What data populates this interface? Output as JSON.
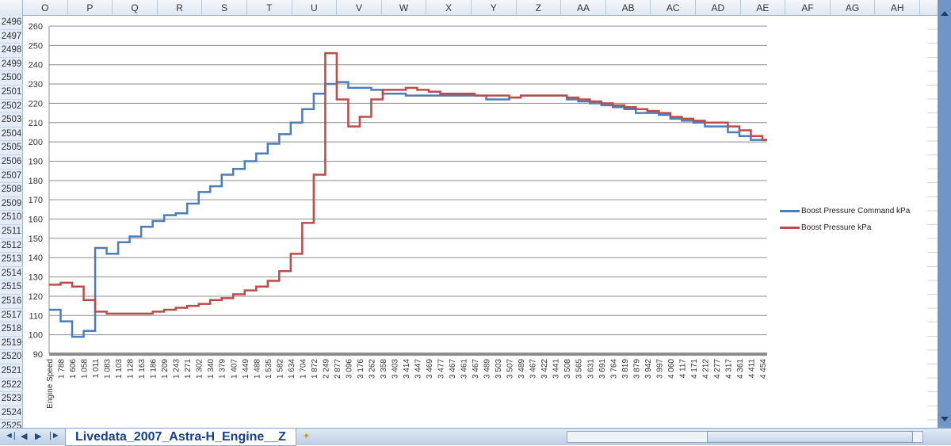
{
  "columns": [
    "O",
    "P",
    "Q",
    "R",
    "S",
    "T",
    "U",
    "V",
    "W",
    "X",
    "Y",
    "Z",
    "AA",
    "AB",
    "AC",
    "AD",
    "AE",
    "AF",
    "AG",
    "AH"
  ],
  "rows": [
    "2496",
    "2497",
    "2498",
    "2499",
    "2500",
    "2501",
    "2502",
    "2503",
    "2504",
    "2505",
    "2506",
    "2507",
    "2508",
    "2509",
    "2510",
    "2511",
    "2512",
    "2513",
    "2514",
    "2515",
    "2516",
    "2517",
    "2518",
    "2519",
    "2520",
    "2521",
    "2522",
    "2523",
    "2524",
    "2525"
  ],
  "sheet_tab": "Livedata_2007_Astra-H_Engine__Z",
  "colors": {
    "command": "#4a7ebb",
    "actual": "#be4b48"
  },
  "chart_data": {
    "type": "line",
    "title": "",
    "xlabel": "",
    "ylabel": "",
    "ylim": [
      90,
      260
    ],
    "yticks": [
      90,
      100,
      110,
      120,
      130,
      140,
      150,
      160,
      170,
      180,
      190,
      200,
      210,
      220,
      230,
      240,
      250,
      260
    ],
    "grid": true,
    "legend_position": "right",
    "categories": [
      "Engine Speed",
      "1 788",
      "1 606",
      "1 058",
      "1 011",
      "1 083",
      "1 103",
      "1 128",
      "1 163",
      "1 186",
      "1 209",
      "1 243",
      "1 271",
      "1 302",
      "1 340",
      "1 379",
      "1 407",
      "1 449",
      "1 488",
      "1 535",
      "1 582",
      "1 634",
      "1 704",
      "1 872",
      "2 249",
      "2 877",
      "3 096",
      "3 176",
      "3 262",
      "3 358",
      "3 403",
      "3 414",
      "3 447",
      "3 469",
      "3 477",
      "3 467",
      "3 461",
      "3 467",
      "3 489",
      "3 503",
      "3 507",
      "3 489",
      "3 467",
      "3 422",
      "3 441",
      "3 508",
      "3 565",
      "3 631",
      "3 691",
      "3 764",
      "3 819",
      "3 879",
      "3 942",
      "3 997",
      "4 060",
      "4 117",
      "4 171",
      "4 212",
      "4 277",
      "4 317",
      "4 361",
      "4 411",
      "4 454"
    ],
    "series": [
      {
        "name": "Boost Pressure Command  kPa",
        "values": [
          113,
          107,
          99,
          102,
          145,
          142,
          148,
          151,
          156,
          159,
          162,
          163,
          168,
          174,
          177,
          183,
          186,
          190,
          194,
          199,
          204,
          210,
          217,
          225,
          230,
          231,
          228,
          228,
          227,
          225,
          225,
          224,
          224,
          224,
          224,
          224,
          224,
          224,
          222,
          222,
          223,
          224,
          224,
          224,
          224,
          222,
          221,
          220,
          219,
          218,
          217,
          215,
          215,
          214,
          212,
          211,
          210,
          208,
          208,
          205,
          203,
          201,
          201
        ]
      },
      {
        "name": "Boost Pressure kPa",
        "values": [
          126,
          127,
          125,
          118,
          112,
          111,
          111,
          111,
          111,
          112,
          113,
          114,
          115,
          116,
          118,
          119,
          121,
          123,
          125,
          128,
          133,
          142,
          158,
          183,
          246,
          222,
          208,
          213,
          222,
          227,
          227,
          228,
          227,
          226,
          225,
          225,
          225,
          224,
          224,
          224,
          223,
          224,
          224,
          224,
          224,
          223,
          222,
          221,
          220,
          219,
          218,
          217,
          216,
          215,
          213,
          212,
          211,
          210,
          210,
          208,
          206,
          203,
          201
        ]
      }
    ]
  }
}
